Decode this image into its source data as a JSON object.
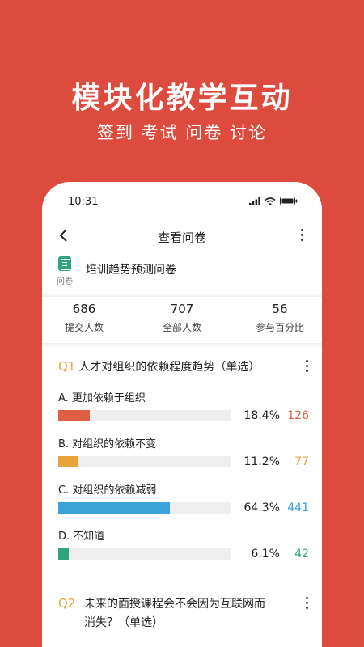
{
  "hero": {
    "title": "模块化教学互动",
    "subtitle": "签到 考试 问卷 讨论"
  },
  "status_bar": {
    "time": "10:31"
  },
  "nav": {
    "back_icon": "chevron-left-icon",
    "title": "查看问卷",
    "menu_icon": "more-vertical-icon"
  },
  "questionnaire": {
    "icon_label": "问卷",
    "title": "培训趋势预测问卷"
  },
  "stats": [
    {
      "value": "686",
      "label": "提交人数"
    },
    {
      "value": "707",
      "label": "全部人数"
    },
    {
      "value": "56",
      "label": "参与百分比"
    }
  ],
  "questions": [
    {
      "code": "Q1",
      "text": "人才对组织的依赖程度趋势（单选）",
      "options": [
        {
          "label": "A. 更加依赖于组织",
          "percent_text": "18.4%",
          "percent": 18.4,
          "count": "126",
          "color": "#e05d43"
        },
        {
          "label": "B. 对组织的依赖不变",
          "percent_text": "11.2%",
          "percent": 11.2,
          "count": "77",
          "color": "#e8a33d"
        },
        {
          "label": "C. 对组织的依赖减弱",
          "percent_text": "64.3%",
          "percent": 64.3,
          "count": "441",
          "color": "#3aa2d7"
        },
        {
          "label": "D. 不知道",
          "percent_text": "6.1%",
          "percent": 6.1,
          "count": "42",
          "color": "#2fa57e"
        }
      ]
    },
    {
      "code": "Q2",
      "text_line1": "未来的面授课程会不会因为互联网而",
      "text_line2": "消失？（单选）"
    }
  ],
  "colors": {
    "background": "#dd4b3e",
    "accent_q": "#e8a33d"
  }
}
